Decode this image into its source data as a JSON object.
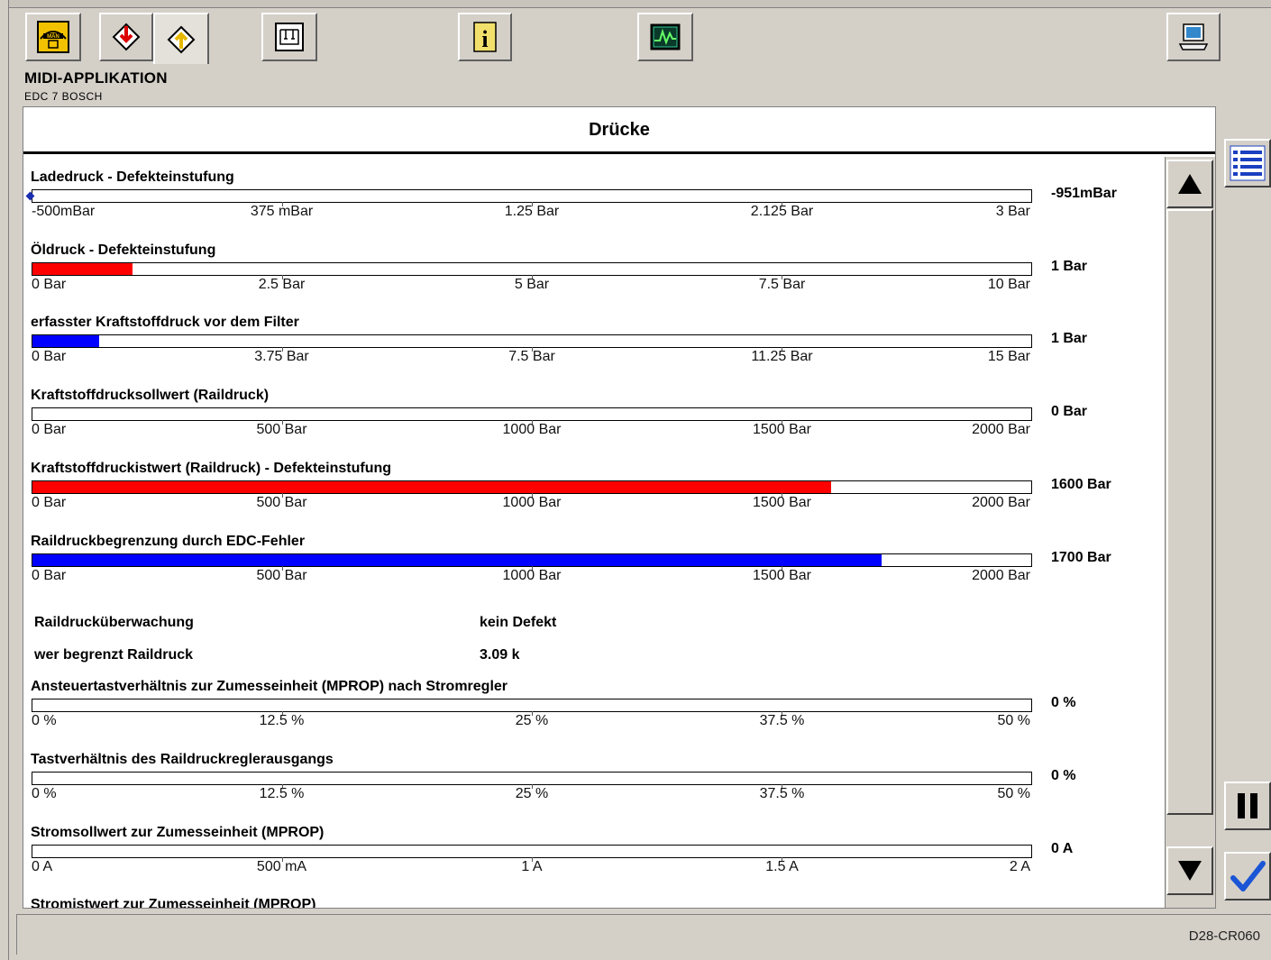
{
  "toolbar": {
    "buttons": [
      {
        "name": "man-home-icon"
      },
      {
        "name": "download-to-vehicle-icon"
      },
      {
        "name": "upload-from-vehicle-icon"
      },
      {
        "name": "wiring-diagram-icon"
      },
      {
        "name": "info-icon"
      },
      {
        "name": "oscilloscope-icon"
      },
      {
        "name": "laptop-icon"
      }
    ]
  },
  "header": {
    "title": "MIDI-APPLIKATION",
    "subtitle": "EDC 7 BOSCH"
  },
  "panel": {
    "title": "Drücke"
  },
  "colors": {
    "red_fill": "#ff0000",
    "blue_fill": "#0000ff",
    "marker": "#1a2fb0"
  },
  "items": [
    {
      "label": "Ladedruck - Defekteinstufung",
      "value": "-951mBar",
      "fill_fraction": 0,
      "fill_color": "none",
      "marker": true,
      "ticks": [
        "-500mBar",
        "375 mBar",
        "1.25 Bar",
        "2.125 Bar",
        "3 Bar"
      ]
    },
    {
      "label": "Öldruck - Defekteinstufung",
      "value": "1 Bar",
      "fill_fraction": 0.1,
      "fill_color": "#ff0000",
      "marker": false,
      "ticks": [
        "0 Bar",
        "2.5 Bar",
        "5 Bar",
        "7.5 Bar",
        "10 Bar"
      ]
    },
    {
      "label": "erfasster Kraftstoffdruck vor dem Filter",
      "value": "1 Bar",
      "fill_fraction": 0.0667,
      "fill_color": "#0000ff",
      "marker": false,
      "ticks": [
        "0 Bar",
        "3.75 Bar",
        "7.5 Bar",
        "11.25 Bar",
        "15 Bar"
      ]
    },
    {
      "label": "Kraftstoffdrucksollwert (Raildruck)",
      "value": "0 Bar",
      "fill_fraction": 0,
      "fill_color": "none",
      "marker": false,
      "ticks": [
        "0 Bar",
        "500 Bar",
        "1000 Bar",
        "1500 Bar",
        "2000 Bar"
      ]
    },
    {
      "label": "Kraftstoffdruckistwert (Raildruck) - Defekteinstufung",
      "value": "1600 Bar",
      "fill_fraction": 0.8,
      "fill_color": "#ff0000",
      "marker": false,
      "ticks": [
        "0 Bar",
        "500 Bar",
        "1000 Bar",
        "1500 Bar",
        "2000 Bar"
      ]
    },
    {
      "label": "Raildruckbegrenzung durch EDC-Fehler",
      "value": "1700 Bar",
      "fill_fraction": 0.85,
      "fill_color": "#0000ff",
      "marker": false,
      "ticks": [
        "0 Bar",
        "500 Bar",
        "1000 Bar",
        "1500 Bar",
        "2000 Bar"
      ]
    }
  ],
  "kv": [
    {
      "label": "Raildrucküberwachung",
      "value": "kein Defekt"
    },
    {
      "label": "wer begrenzt Raildruck",
      "value": "3.09 k"
    }
  ],
  "items2": [
    {
      "label": "Ansteuertastverhältnis zur Zumesseinheit (MPROP) nach Stromregler",
      "value": "0 %",
      "fill_fraction": 0,
      "fill_color": "none",
      "marker": false,
      "ticks": [
        "0 %",
        "12.5 %",
        "25 %",
        "37.5 %",
        "50 %"
      ]
    },
    {
      "label": "Tastverhältnis des Raildruckreglerausgangs",
      "value": "0 %",
      "fill_fraction": 0,
      "fill_color": "none",
      "marker": false,
      "ticks": [
        "0 %",
        "12.5 %",
        "25 %",
        "37.5 %",
        "50 %"
      ]
    },
    {
      "label": "Stromsollwert zur Zumesseinheit (MPROP)",
      "value": "0 A",
      "fill_fraction": 0,
      "fill_color": "none",
      "marker": false,
      "ticks": [
        "0 A",
        "500 mA",
        "1 A",
        "1.5 A",
        "2 A"
      ]
    },
    {
      "label": "Stromistwert zur Zumesseinheit (MPROP)",
      "value": "",
      "fill_fraction": 0,
      "fill_color": "none",
      "marker": false,
      "ticks": []
    }
  ],
  "sidebar": {
    "list_button": "list-view-icon",
    "pause_button": "pause-icon",
    "confirm_button": "checkmark-icon"
  },
  "statusbar": {
    "code": "D28-CR060"
  }
}
